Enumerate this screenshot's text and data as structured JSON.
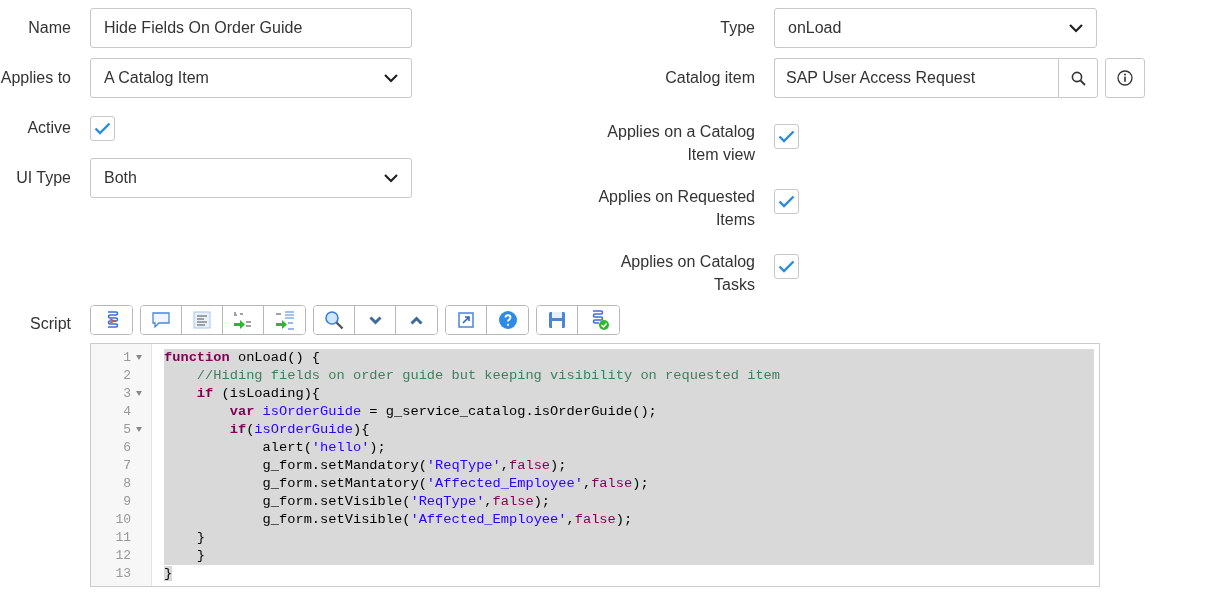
{
  "left": [
    {
      "kind": "text",
      "label": "Name",
      "value": "Hide Fields On Order Guide"
    },
    {
      "kind": "select",
      "label": "Applies to",
      "value": "A Catalog Item"
    },
    {
      "kind": "checkbox",
      "label": "Active",
      "checked": true
    },
    {
      "kind": "select",
      "label": "UI Type",
      "value": "Both"
    }
  ],
  "right": [
    {
      "kind": "select",
      "label": "Type",
      "value": "onLoad"
    },
    {
      "kind": "reference",
      "label": "Catalog item",
      "value": "SAP User Access Request"
    },
    {
      "kind": "checkbox",
      "label": "Applies on a Catalog Item view",
      "checked": true
    },
    {
      "kind": "checkbox",
      "label": "Applies on Requested Items",
      "checked": true
    },
    {
      "kind": "checkbox",
      "label": "Applies on Catalog Tasks",
      "checked": true
    }
  ],
  "script": {
    "label": "Script",
    "lines": [
      {
        "number": "1",
        "foldable": true,
        "selected": true,
        "tokens": [
          {
            "kind": "keyword",
            "text": "function"
          },
          {
            "kind": "plain",
            "text": " onLoad() {"
          }
        ]
      },
      {
        "number": "2",
        "foldable": false,
        "selected": true,
        "tokens": [
          {
            "kind": "comment",
            "text": "    //Hiding fields on order guide but keeping visibility on requested item"
          }
        ]
      },
      {
        "number": "3",
        "foldable": true,
        "selected": true,
        "tokens": [
          {
            "kind": "keyword",
            "text": "    if"
          },
          {
            "kind": "plain",
            "text": " (isLoading){"
          }
        ]
      },
      {
        "number": "4",
        "foldable": false,
        "selected": true,
        "tokens": [
          {
            "kind": "keyword",
            "text": "        var"
          },
          {
            "kind": "variable",
            "text": " isOrderGuide"
          },
          {
            "kind": "plain",
            "text": " = g_service_catalog.isOrderGuide();"
          }
        ]
      },
      {
        "number": "5",
        "foldable": true,
        "selected": true,
        "tokens": [
          {
            "kind": "keyword",
            "text": "        if"
          },
          {
            "kind": "plain",
            "text": "("
          },
          {
            "kind": "variable",
            "text": "isOrderGuide"
          },
          {
            "kind": "plain",
            "text": "){"
          }
        ]
      },
      {
        "number": "6",
        "foldable": false,
        "selected": true,
        "tokens": [
          {
            "kind": "plain",
            "text": "            alert("
          },
          {
            "kind": "string",
            "text": "'hello'"
          },
          {
            "kind": "plain",
            "text": ");"
          }
        ]
      },
      {
        "number": "7",
        "foldable": false,
        "selected": true,
        "tokens": [
          {
            "kind": "plain",
            "text": "            g_form.setMandatory("
          },
          {
            "kind": "string",
            "text": "'ReqType'"
          },
          {
            "kind": "plain",
            "text": ","
          },
          {
            "kind": "literal",
            "text": "false"
          },
          {
            "kind": "plain",
            "text": ");"
          }
        ]
      },
      {
        "number": "8",
        "foldable": false,
        "selected": true,
        "tokens": [
          {
            "kind": "plain",
            "text": "            g_form.setMantatory("
          },
          {
            "kind": "string",
            "text": "'Affected_Employee'"
          },
          {
            "kind": "plain",
            "text": ","
          },
          {
            "kind": "literal",
            "text": "false"
          },
          {
            "kind": "plain",
            "text": ");"
          }
        ]
      },
      {
        "number": "9",
        "foldable": false,
        "selected": true,
        "tokens": [
          {
            "kind": "plain",
            "text": "            g_form.setVisible("
          },
          {
            "kind": "string",
            "text": "'ReqType'"
          },
          {
            "kind": "plain",
            "text": ","
          },
          {
            "kind": "literal",
            "text": "false"
          },
          {
            "kind": "plain",
            "text": ");"
          }
        ]
      },
      {
        "number": "10",
        "foldable": false,
        "selected": true,
        "tokens": [
          {
            "kind": "plain",
            "text": "            g_form.setVisible("
          },
          {
            "kind": "string",
            "text": "'Affected_Employee'"
          },
          {
            "kind": "plain",
            "text": ","
          },
          {
            "kind": "literal",
            "text": "false"
          },
          {
            "kind": "plain",
            "text": ");"
          }
        ]
      },
      {
        "number": "11",
        "foldable": false,
        "selected": true,
        "tokens": [
          {
            "kind": "plain",
            "text": "    }"
          }
        ]
      },
      {
        "number": "12",
        "foldable": false,
        "selected": true,
        "tokens": [
          {
            "kind": "plain",
            "text": "    }"
          }
        ]
      },
      {
        "number": "13",
        "foldable": false,
        "selected": true,
        "tokens": [
          {
            "kind": "plain",
            "text": "}"
          }
        ]
      }
    ]
  }
}
